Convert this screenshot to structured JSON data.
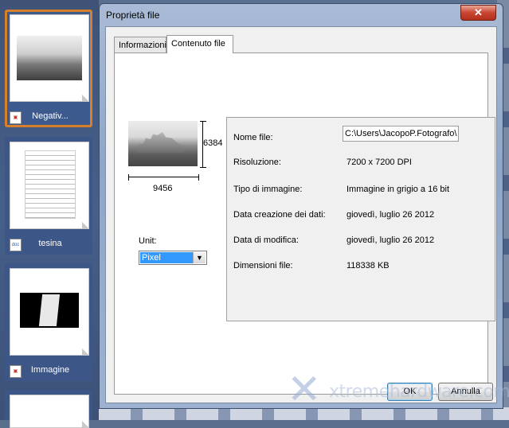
{
  "thumbnails": [
    {
      "label": "Negativ...",
      "icon": "image-file-icon",
      "selected": true
    },
    {
      "label": "tesina",
      "icon": "doc-file-icon",
      "icon_text": "doc"
    },
    {
      "label": "Immagine",
      "icon": "image-file-icon"
    }
  ],
  "dialog": {
    "title": "Proprietà file",
    "close_glyph": "✕",
    "tabs": [
      {
        "label": "Informazioni",
        "active": false
      },
      {
        "label": "Contenuto file",
        "active": true
      }
    ],
    "preview": {
      "width_value": "9456",
      "height_value": "6384",
      "unit_label": "Unit:",
      "unit_selected": "Pixel"
    },
    "info": {
      "file_name_label": "Nome file:",
      "file_name_value": "C:\\Users\\JacopoP.Fotografo\\",
      "resolution_label": "Risoluzione:",
      "resolution_value": "7200 x 7200 DPI",
      "image_type_label": "Tipo di immagine:",
      "image_type_value": "Immagine in grigio a 16 bit",
      "created_label": "Data creazione dei dati:",
      "created_value": "giovedì, luglio 26 2012",
      "modified_label": "Data di modifica:",
      "modified_value": "giovedì, luglio 26 2012",
      "size_label": "Dimensioni file:",
      "size_value": "118338 KB"
    },
    "ok_label": "OK",
    "cancel_label": "Annulla"
  },
  "watermark": "xtremehardware.com",
  "colors": {
    "selection": "#d87f2a",
    "dropdown_highlight": "#3399ff",
    "close_button": "#c9452f"
  }
}
